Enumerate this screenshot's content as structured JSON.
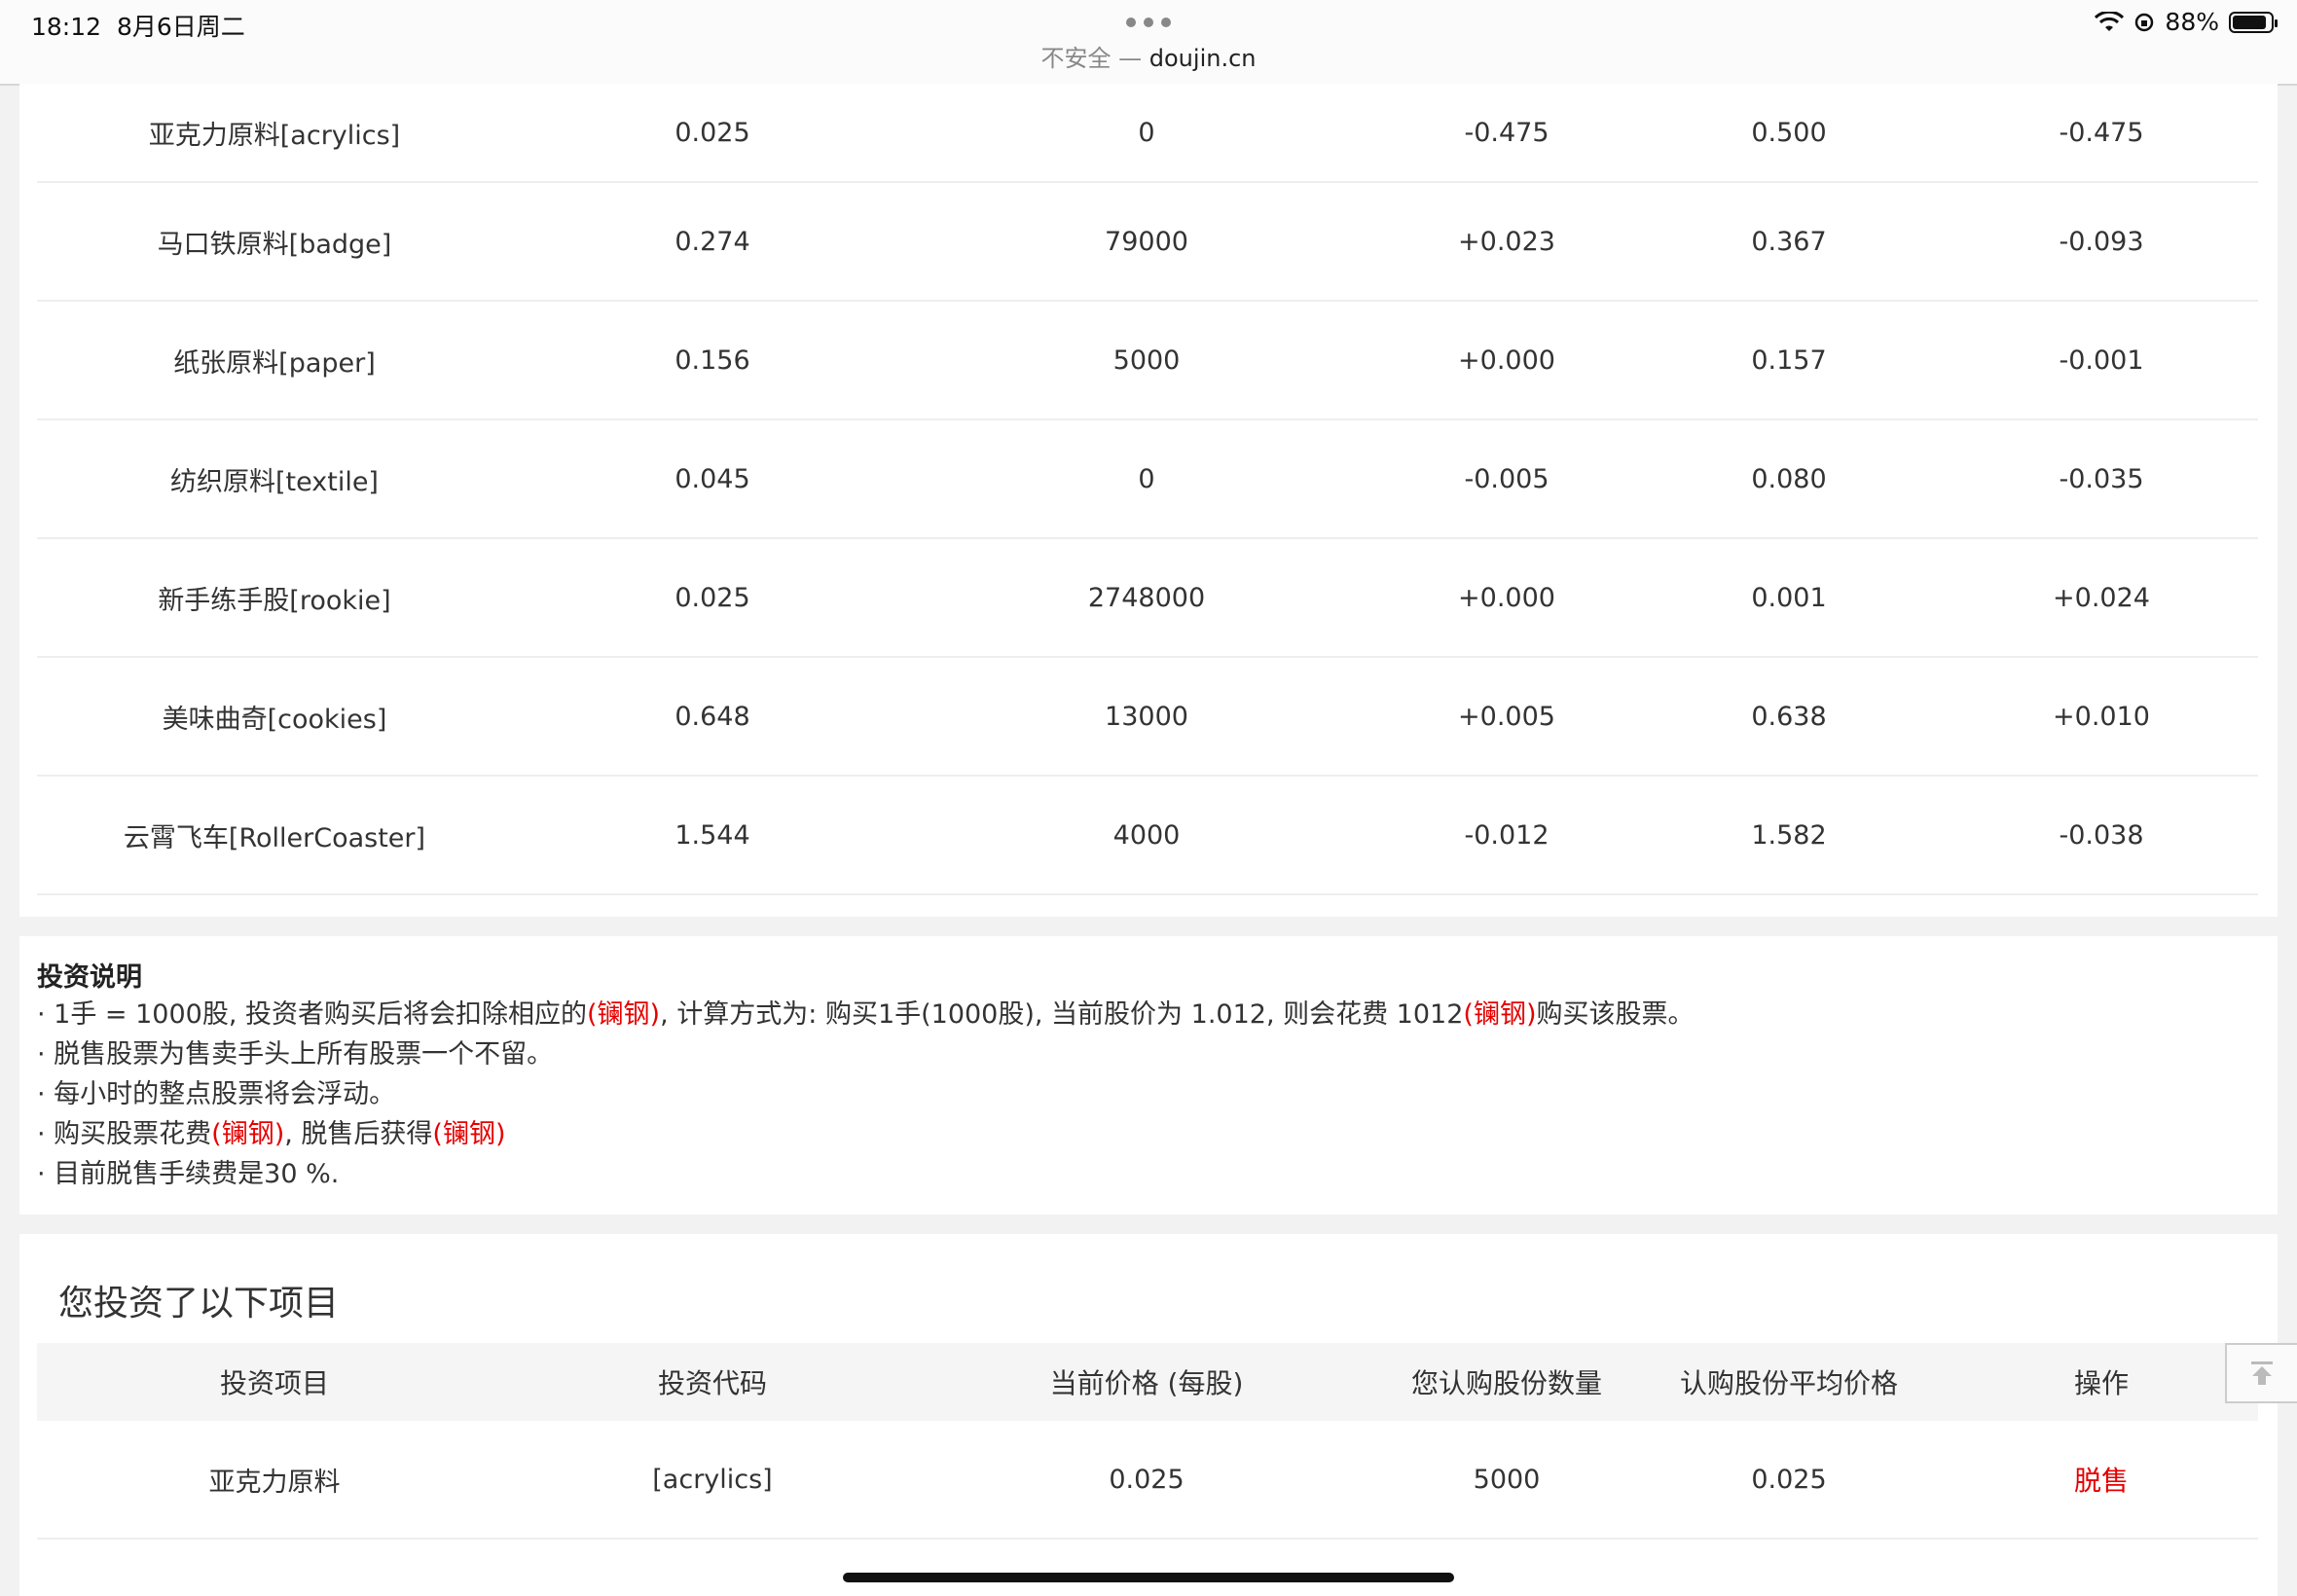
{
  "status_bar": {
    "time": "18:12",
    "date": "8月6日周二",
    "battery": "88%"
  },
  "address_bar": {
    "security": "不安全 — ",
    "host": "doujin.cn"
  },
  "stocks": [
    {
      "name": "亚克力原料[acrylics]",
      "price": "0.025",
      "volume": "0",
      "change": "-0.475",
      "change_dir": "down",
      "ref": "0.500",
      "total": "-0.475",
      "total_dir": "down"
    },
    {
      "name": "马口铁原料[badge]",
      "price": "0.274",
      "volume": "79000",
      "change": "+0.023",
      "change_dir": "up",
      "ref": "0.367",
      "total": "-0.093",
      "total_dir": "down"
    },
    {
      "name": "纸张原料[paper]",
      "price": "0.156",
      "volume": "5000",
      "change": "+0.000",
      "change_dir": "flat",
      "ref": "0.157",
      "total": "-0.001",
      "total_dir": "down"
    },
    {
      "name": "纺织原料[textile]",
      "price": "0.045",
      "volume": "0",
      "change": "-0.005",
      "change_dir": "down",
      "ref": "0.080",
      "total": "-0.035",
      "total_dir": "down"
    },
    {
      "name": "新手练手股[rookie]",
      "price": "0.025",
      "volume": "2748000",
      "change": "+0.000",
      "change_dir": "flat",
      "ref": "0.001",
      "total": "+0.024",
      "total_dir": "up"
    },
    {
      "name": "美味曲奇[cookies]",
      "price": "0.648",
      "volume": "13000",
      "change": "+0.005",
      "change_dir": "up",
      "ref": "0.638",
      "total": "+0.010",
      "total_dir": "up"
    },
    {
      "name": "云霄飞车[RollerCoaster]",
      "price": "1.544",
      "volume": "4000",
      "change": "-0.012",
      "change_dir": "down",
      "ref": "1.582",
      "total": "-0.038",
      "total_dir": "down"
    }
  ],
  "info": {
    "title": "投资说明",
    "line1_a": "· 1手 = 1000股, 投资者购买后将会扣除相应的",
    "currency": "(镧钢)",
    "line1_b": ", 计算方式为: 购买1手(1000股), 当前股价为 1.012, 则会花费 1012",
    "line1_c": "购买该股票。",
    "line2": "· 脱售股票为售卖手头上所有股票一个不留。",
    "line3": "· 每小时的整点股票将会浮动。",
    "line4_a": "· 购买股票花费",
    "line4_b": ", 脱售后获得",
    "line5": "· 目前脱售手续费是30 %."
  },
  "investments": {
    "title": "您投资了以下项目",
    "headers": [
      "投资项目",
      "投资代码",
      "当前价格 (每股)",
      "您认购股份数量",
      "认购股份平均价格",
      "操作"
    ],
    "rows": [
      {
        "item": "亚克力原料",
        "code": "[acrylics]",
        "price": "0.025",
        "qty": "5000",
        "avg": "0.025",
        "action": "脱售"
      }
    ]
  }
}
